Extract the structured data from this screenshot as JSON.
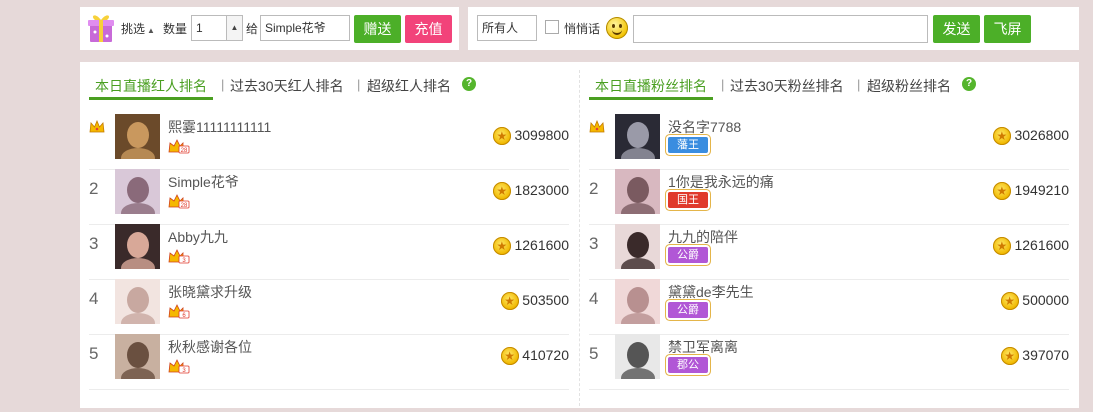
{
  "gift_bar": {
    "pick_label": "挑选",
    "qty_label": "数量",
    "qty_value": "1",
    "to_label": "给",
    "recipient": "Simple花爷",
    "gift_button": "赠送",
    "recharge_button": "充值"
  },
  "chat_bar": {
    "target": "所有人",
    "whisper_label": "悄悄话",
    "message": "",
    "send_button": "发送",
    "fly_button": "飞屏"
  },
  "host_ranking": {
    "tabs": [
      "本日直播红人排名",
      "过去30天红人排名",
      "超级红人排名"
    ],
    "help": "?",
    "rows": [
      {
        "rank": "1",
        "name": "熙霎11111111111",
        "amount": "3099800",
        "level": "28"
      },
      {
        "rank": "2",
        "name": "Simple花爷",
        "amount": "1823000",
        "level": "28"
      },
      {
        "rank": "3",
        "name": "Abby九九",
        "amount": "1261600",
        "level": "3"
      },
      {
        "rank": "4",
        "name": "张晓黛求升级",
        "amount": "503500",
        "level": "6"
      },
      {
        "rank": "5",
        "name": "秋秋感谢各位",
        "amount": "410720",
        "level": "3"
      }
    ]
  },
  "fan_ranking": {
    "tabs": [
      "本日直播粉丝排名",
      "过去30天粉丝排名",
      "超级粉丝排名"
    ],
    "help": "?",
    "rows": [
      {
        "rank": "1",
        "name": "没名字7788",
        "amount": "3026800",
        "badge": "藩王",
        "badge_color": "#3a8de0"
      },
      {
        "rank": "2",
        "name": "1你是我永远的痛",
        "amount": "1949210",
        "badge": "国王",
        "badge_color": "#e0392b"
      },
      {
        "rank": "3",
        "name": "九九的陪伴",
        "amount": "1261600",
        "badge": "公爵",
        "badge_color": "#b157d6"
      },
      {
        "rank": "4",
        "name": "黛黛de李先生",
        "amount": "500000",
        "badge": "公爵",
        "badge_color": "#b157d6"
      },
      {
        "rank": "5",
        "name": "禁卫军离离",
        "amount": "397070",
        "badge": "郡公",
        "badge_color": "#b157d6"
      }
    ]
  }
}
